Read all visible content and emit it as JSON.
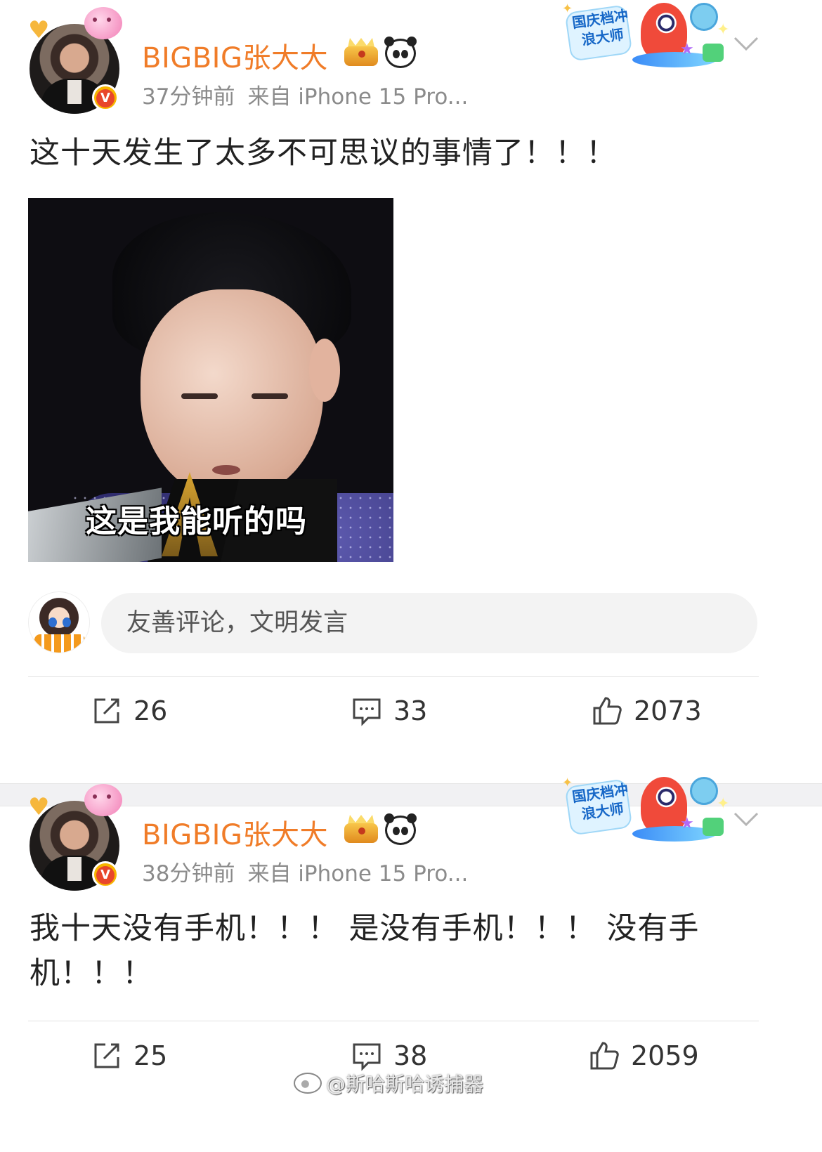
{
  "posts": [
    {
      "username": "BIGBIG张大大",
      "time": "37分钟前",
      "source": "来自 iPhone 15 Pro...",
      "promo_text": "国庆档冲浪大师",
      "text": "这十天发生了太多不可思议的事情了！！！",
      "image_caption": "这是我能听的吗",
      "comment_placeholder": "友善评论，文明发言",
      "reposts": "26",
      "comments": "33",
      "likes": "2073"
    },
    {
      "username": "BIGBIG张大大",
      "time": "38分钟前",
      "source": "来自 iPhone 15 Pro...",
      "promo_text": "国庆档冲浪大师",
      "text_line1": "我十天没有手机！！！ 是没有手机！！！ 没有手",
      "text_line2": "机！！！",
      "reposts": "25",
      "comments": "38",
      "likes": "2059"
    }
  ],
  "watermark": "@斯哈斯哈诱捕器",
  "colors": {
    "username": "#f07c28",
    "meta": "#8b8b8b",
    "separator": "#f1f1f3"
  },
  "icons": [
    "repost-icon",
    "comment-icon",
    "like-icon",
    "chevron-down-icon",
    "crown-badge-icon",
    "panda-badge-icon",
    "verified-v-icon"
  ]
}
